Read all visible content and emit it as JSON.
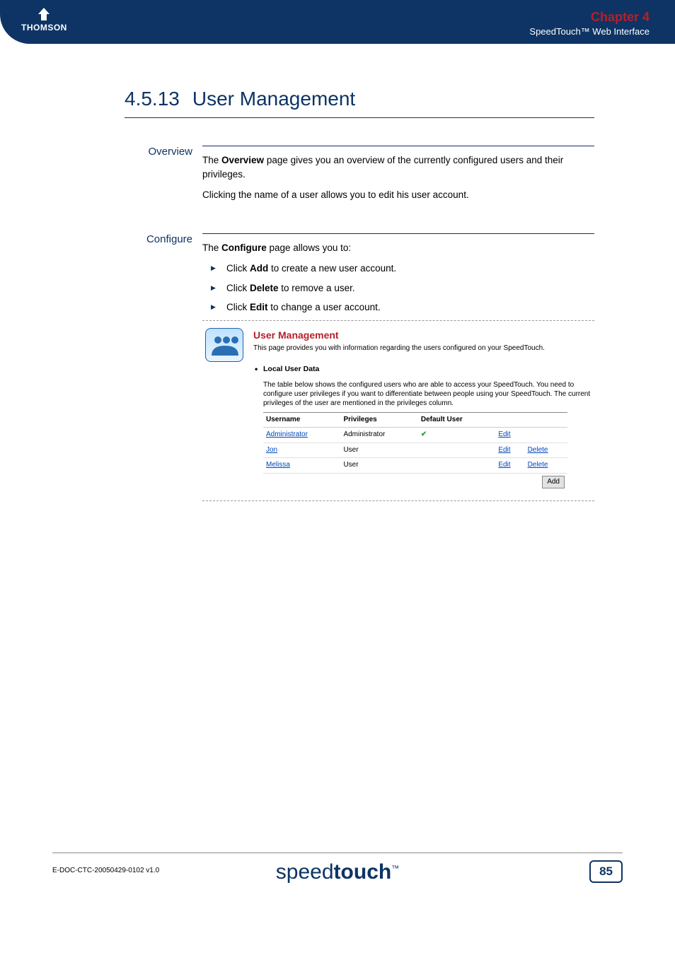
{
  "header": {
    "logo_text": "THOMSON",
    "chapter": "Chapter 4",
    "subtitle": "SpeedTouch™ Web Interface"
  },
  "section": {
    "number": "4.5.13",
    "title": "User Management"
  },
  "overview": {
    "label": "Overview",
    "para1_pre": "The ",
    "para1_bold": "Overview",
    "para1_post": " page gives you an overview of the currently configured users and their privileges.",
    "para2": "Clicking the name of a user allows you to edit his user account."
  },
  "configure": {
    "label": "Configure",
    "intro_pre": "The ",
    "intro_bold": "Configure",
    "intro_post": " page allows you to:",
    "items": {
      "0": {
        "pre": "Click ",
        "bold": "Add",
        "post": " to create a new user account."
      },
      "1": {
        "pre": "Click ",
        "bold": "Delete",
        "post": " to remove a user."
      },
      "2": {
        "pre": "Click ",
        "bold": "Edit",
        "post": " to change a user account."
      }
    }
  },
  "screenshot": {
    "title": "User Management",
    "desc": "This page provides you with information regarding the users configured on your SpeedTouch.",
    "subhead": "Local User Data",
    "note": "The table below shows the configured users who are able to access your SpeedTouch. You need to configure user privileges if you want to differentiate between people using your SpeedTouch. The current privileges of the user are mentioned in the privileges column.",
    "columns": {
      "c0": "Username",
      "c1": "Privileges",
      "c2": "Default User"
    },
    "rows": {
      "0": {
        "name": "Administrator",
        "priv": "Administrator",
        "default": true,
        "edit": "Edit",
        "del": ""
      },
      "1": {
        "name": "Jon",
        "priv": "User",
        "default": false,
        "edit": "Edit",
        "del": "Delete"
      },
      "2": {
        "name": "Melissa",
        "priv": "User",
        "default": false,
        "edit": "Edit",
        "del": "Delete"
      }
    },
    "add": "Add"
  },
  "footer": {
    "doc_code": "E-DOC-CTC-20050429-0102 v1.0",
    "brand_pre": "speed",
    "brand_bold": "touch",
    "brand_tm": "™",
    "page": "85"
  }
}
